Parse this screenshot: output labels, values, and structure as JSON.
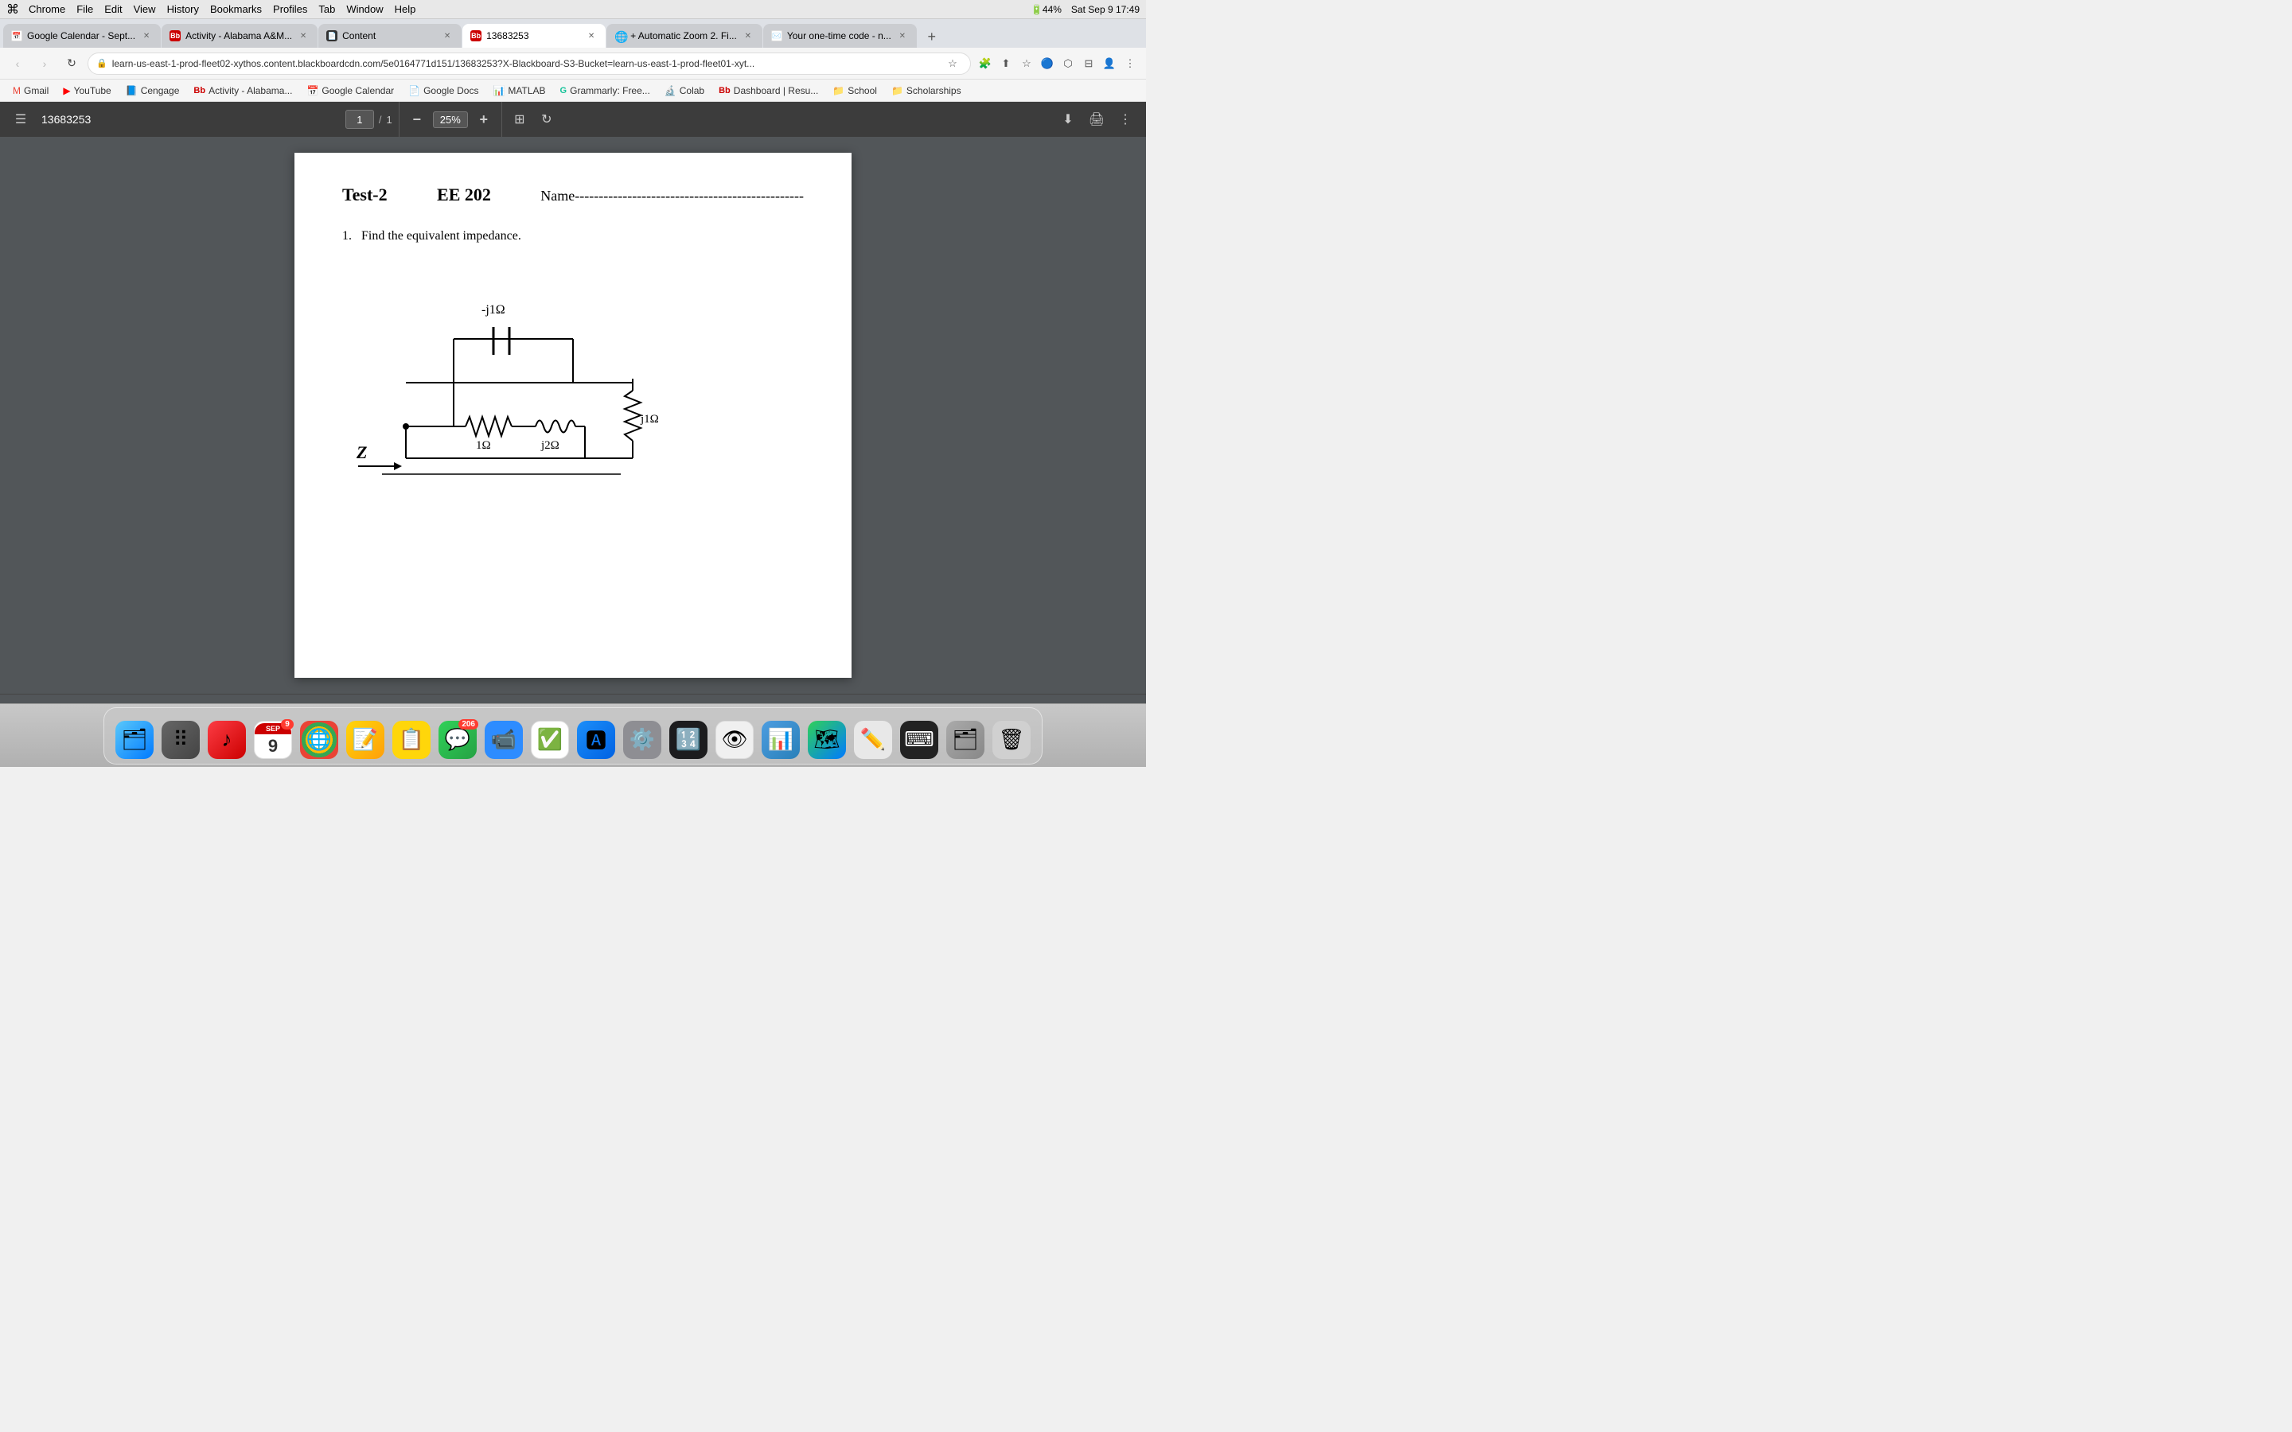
{
  "menubar": {
    "apple": "⌘",
    "app": "Chrome",
    "items": [
      "File",
      "Edit",
      "View",
      "History",
      "Bookmarks",
      "Profiles",
      "Tab",
      "Window",
      "Help"
    ],
    "right_items": [
      "Sat Sep 9  17:49"
    ]
  },
  "tabs": [
    {
      "id": "tab-calendar",
      "title": "Google Calendar - Sept...",
      "favicon_type": "calendar",
      "active": false
    },
    {
      "id": "tab-activity",
      "title": "Activity - Alabama A&M...",
      "favicon_type": "bb",
      "active": false
    },
    {
      "id": "tab-content",
      "title": "Content",
      "favicon_type": "content",
      "active": false
    },
    {
      "id": "tab-13683253",
      "title": "13683253",
      "favicon_type": "bb",
      "active": true
    },
    {
      "id": "tab-zoom",
      "title": "+ Automatic Zoom 2. Fi...",
      "favicon_type": "chrome",
      "active": false
    },
    {
      "id": "tab-onetime",
      "title": "Your one-time code - n...",
      "favicon_type": "calendar",
      "active": false
    }
  ],
  "addressbar": {
    "url": "learn-us-east-1-prod-fleet02-xythos.content.blackboardcdn.com/5e0164771d151/13683253?X-Blackboard-S3-Bucket=learn-us-east-1-prod-fleet01-xyt...",
    "lock_icon": "🔒"
  },
  "bookmarks": [
    {
      "id": "bm-gmail",
      "label": "Gmail",
      "color": "#EA4335"
    },
    {
      "id": "bm-youtube",
      "label": "YouTube",
      "color": "#FF0000"
    },
    {
      "id": "bm-cengage",
      "label": "Cengage",
      "color": "#005A8E"
    },
    {
      "id": "bm-activity",
      "label": "Activity - Alabama...",
      "color": "#c00"
    },
    {
      "id": "bm-gcal",
      "label": "Google Calendar",
      "color": "#1a73e8"
    },
    {
      "id": "bm-gdocs",
      "label": "Google Docs",
      "color": "#4285F4"
    },
    {
      "id": "bm-matlab",
      "label": "MATLAB",
      "color": "#e16f00"
    },
    {
      "id": "bm-grammarly",
      "label": "Grammarly: Free...",
      "color": "#15C39A"
    },
    {
      "id": "bm-colab",
      "label": "Colab",
      "color": "#F9AB00"
    },
    {
      "id": "bm-dashboard",
      "label": "Dashboard | Resu...",
      "color": "#c00"
    },
    {
      "id": "bm-school",
      "label": "School",
      "color": "#555"
    },
    {
      "id": "bm-scholarships",
      "label": "Scholarships",
      "color": "#555"
    }
  ],
  "pdf_toolbar": {
    "menu_icon": "☰",
    "title": "13683253",
    "page_current": "1",
    "page_sep": "/",
    "page_total": "1",
    "zoom_minus": "−",
    "zoom_value": "25%",
    "zoom_plus": "+",
    "download_icon": "⬇",
    "print_icon": "🖨",
    "more_icon": "⋮"
  },
  "pdf_content": {
    "test_title": "Test-2",
    "test_course": "EE 202",
    "test_name": "Name------------------------------------------------",
    "problem_number": "1.",
    "problem_text": "Find the equivalent impedance."
  },
  "dock": {
    "items": [
      {
        "id": "finder",
        "label": "Finder",
        "emoji": "😀",
        "bg": "#5ac8fa",
        "badge": null
      },
      {
        "id": "launchpad",
        "label": "Launchpad",
        "emoji": "🚀",
        "bg": "#e8e8e8",
        "badge": null
      },
      {
        "id": "music",
        "label": "Music",
        "emoji": "🎵",
        "bg": "#fc3c44",
        "badge": null
      },
      {
        "id": "calendar-dock",
        "label": "Calendar",
        "emoji": "📅",
        "bg": "#fff",
        "badge": "9"
      },
      {
        "id": "chrome-dock",
        "label": "Chrome",
        "emoji": "🌐",
        "bg": "#fff",
        "badge": null
      },
      {
        "id": "notes-dock",
        "label": "Notes",
        "emoji": "📝",
        "bg": "#ffd60a",
        "badge": null
      },
      {
        "id": "stickies",
        "label": "Stickies",
        "emoji": "📋",
        "bg": "#ffd60a",
        "badge": null
      },
      {
        "id": "messages",
        "label": "Messages",
        "emoji": "💬",
        "bg": "#30d158",
        "badge": "206"
      },
      {
        "id": "zoom-dock",
        "label": "Zoom",
        "emoji": "📹",
        "bg": "#2d8cff",
        "badge": null
      },
      {
        "id": "reminders",
        "label": "Reminders",
        "emoji": "✅",
        "bg": "#ff9f0a",
        "badge": null
      },
      {
        "id": "appstore",
        "label": "App Store",
        "emoji": "🅰",
        "bg": "#1c8ef9",
        "badge": null
      },
      {
        "id": "settings",
        "label": "System Preferences",
        "emoji": "⚙️",
        "bg": "#8e8e93",
        "badge": null
      },
      {
        "id": "calculator",
        "label": "Calculator",
        "emoji": "🔢",
        "bg": "#1c1c1e",
        "badge": null
      },
      {
        "id": "preview",
        "label": "Preview",
        "emoji": "👁",
        "bg": "#f0f0f0",
        "badge": null
      },
      {
        "id": "keynote",
        "label": "Keynote",
        "emoji": "📊",
        "bg": "#4d9de0",
        "badge": null
      },
      {
        "id": "maps",
        "label": "Maps",
        "emoji": "🗺",
        "bg": "#30d158",
        "badge": null
      },
      {
        "id": "scripteditor",
        "label": "Script Editor",
        "emoji": "✏️",
        "bg": "#f5f5f5",
        "badge": null
      },
      {
        "id": "calculator2",
        "label": "Calculator2",
        "emoji": "🔢",
        "bg": "#222",
        "badge": null
      },
      {
        "id": "finder2",
        "label": "Finder2",
        "emoji": "🗂",
        "bg": "#5ac8fa",
        "badge": null
      },
      {
        "id": "trash",
        "label": "Trash",
        "emoji": "🗑",
        "bg": "#e0e0e0",
        "badge": null
      }
    ]
  }
}
